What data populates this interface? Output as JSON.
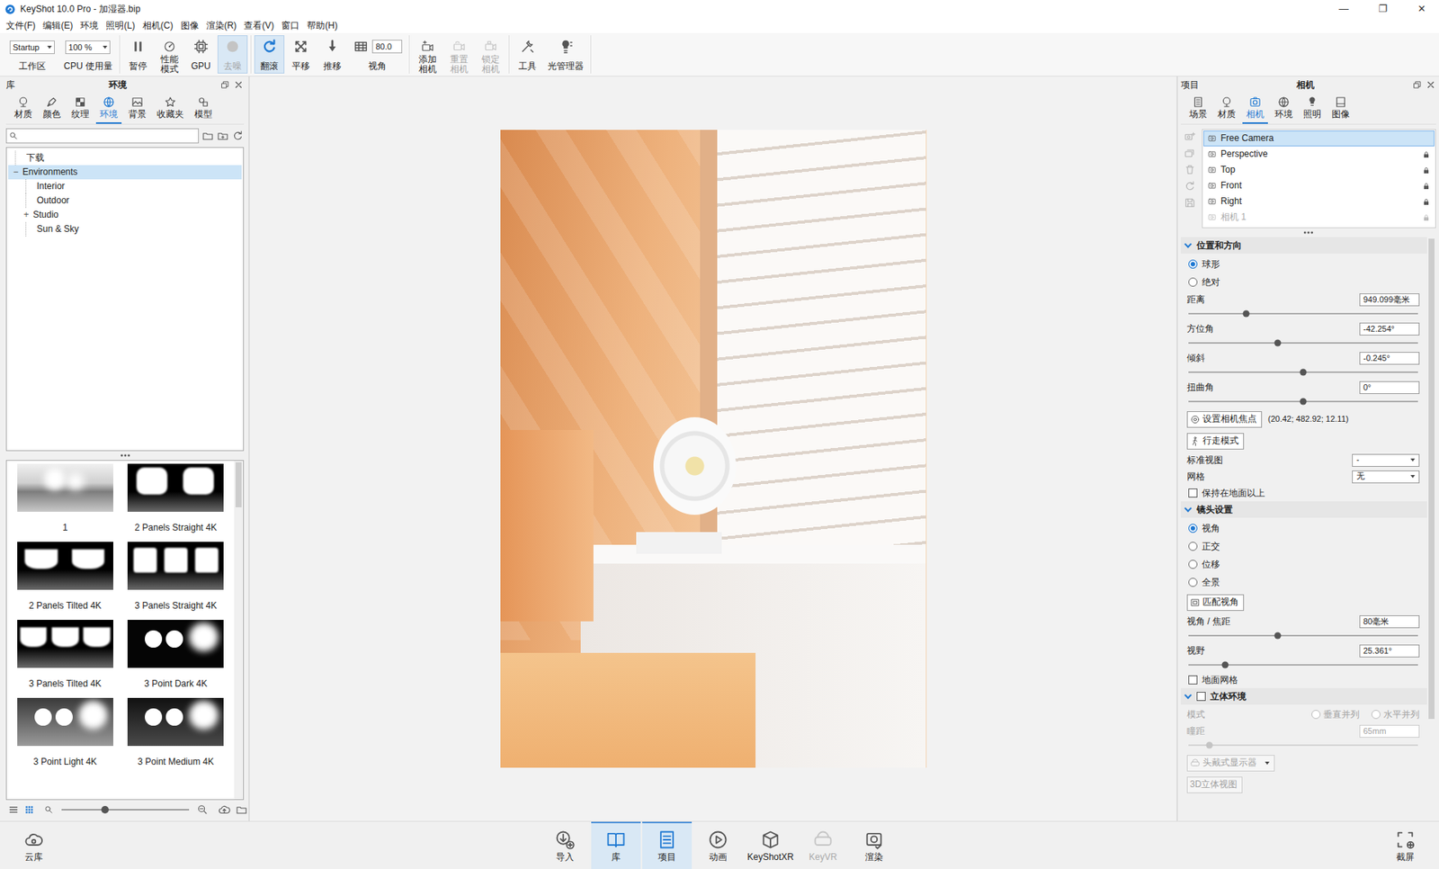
{
  "window": {
    "title": "KeyShot 10.0 Pro - 加湿器.bip",
    "controls": [
      "—",
      "❐",
      "✕"
    ]
  },
  "menu": [
    "文件(F)",
    "编辑(E)",
    "环境",
    "照明(L)",
    "相机(C)",
    "图像",
    "渲染(R)",
    "查看(V)",
    "窗口",
    "帮助(H)"
  ],
  "toolbar": {
    "workspace": {
      "value": "Startup",
      "label": "工作区"
    },
    "cpu": {
      "value": "100 %",
      "label": "CPU 使用量"
    },
    "groups": [
      [
        {
          "label": "暂停",
          "kind": "plain",
          "selected": false,
          "disabled": false
        },
        {
          "label": "性能模式",
          "kind": "stacked",
          "selected": false,
          "disabled": false
        },
        {
          "label": "GPU",
          "kind": "plain",
          "selected": false,
          "disabled": false
        },
        {
          "label": "去噪",
          "kind": "plain",
          "selected": true,
          "disabled": true
        }
      ],
      [
        {
          "label": "翻滚",
          "kind": "plain",
          "selected": true,
          "disabled": false
        },
        {
          "label": "平移",
          "kind": "plain",
          "selected": false,
          "disabled": false
        },
        {
          "label": "推移",
          "kind": "plain",
          "selected": false,
          "disabled": false
        },
        {
          "label": "视角",
          "kind": "field",
          "value": "80.0",
          "selected": false,
          "disabled": false
        }
      ],
      [
        {
          "label": "添加相机",
          "kind": "stacked",
          "selected": false,
          "disabled": false
        },
        {
          "label": "重置相机",
          "kind": "stacked",
          "selected": false,
          "disabled": true
        },
        {
          "label": "锁定相机",
          "kind": "stacked",
          "selected": false,
          "disabled": true
        }
      ],
      [
        {
          "label": "工具",
          "kind": "plain",
          "selected": false,
          "disabled": false
        },
        {
          "label": "光管理器",
          "kind": "plain",
          "selected": false,
          "disabled": false
        }
      ]
    ]
  },
  "library": {
    "title": "库",
    "heading": "环境",
    "tabs": [
      {
        "label": "材质",
        "selected": false
      },
      {
        "label": "颜色",
        "selected": false
      },
      {
        "label": "纹理",
        "selected": false
      },
      {
        "label": "环境",
        "selected": true
      },
      {
        "label": "背景",
        "selected": false
      },
      {
        "label": "收藏夹",
        "selected": false
      },
      {
        "label": "模型",
        "selected": false
      }
    ],
    "tree": [
      {
        "label": "下载",
        "depth": 0,
        "selected": false
      },
      {
        "label": "Environments",
        "depth": 0,
        "toggle": "−",
        "expanded": true,
        "selected": true
      },
      {
        "label": "Interior",
        "depth": 1,
        "selected": false
      },
      {
        "label": "Outdoor",
        "depth": 1,
        "selected": false
      },
      {
        "label": "Studio",
        "depth": 1,
        "toggle": "+",
        "expanded": false,
        "selected": false
      },
      {
        "label": "Sun & Sky",
        "depth": 1,
        "selected": false
      }
    ],
    "thumbnails": [
      {
        "label": "1"
      },
      {
        "label": "2 Panels Straight 4K"
      },
      {
        "label": "2 Panels Tilted 4K"
      },
      {
        "label": "3 Panels Straight 4K"
      },
      {
        "label": "3 Panels Tilted 4K"
      },
      {
        "label": "3 Point Dark 4K"
      },
      {
        "label": "3 Point Light 4K"
      },
      {
        "label": "3 Point Medium 4K"
      }
    ],
    "zoom": {
      "level": 0.34
    }
  },
  "project": {
    "title": "项目",
    "heading": "相机",
    "tabs": [
      {
        "label": "场景",
        "selected": false
      },
      {
        "label": "材质",
        "selected": false
      },
      {
        "label": "相机",
        "selected": true
      },
      {
        "label": "环境",
        "selected": false
      },
      {
        "label": "照明",
        "selected": false
      },
      {
        "label": "图像",
        "selected": false
      }
    ],
    "cameras": [
      {
        "label": "Free Camera",
        "selected": true,
        "locked": false,
        "disabled": false
      },
      {
        "label": "Perspective",
        "selected": false,
        "locked": true,
        "disabled": false
      },
      {
        "label": "Top",
        "selected": false,
        "locked": true,
        "disabled": false
      },
      {
        "label": "Front",
        "selected": false,
        "locked": true,
        "disabled": false
      },
      {
        "label": "Right",
        "selected": false,
        "locked": true,
        "disabled": false
      },
      {
        "label": "相机 1",
        "selected": false,
        "locked": true,
        "disabled": true
      }
    ],
    "sections": [
      {
        "title": "位置和方向",
        "expanded": true,
        "rows": [
          {
            "kind": "radio",
            "label": "球形",
            "selected": true,
            "disabled": false
          },
          {
            "kind": "radio",
            "label": "绝对",
            "selected": false,
            "disabled": false
          },
          {
            "kind": "slider",
            "label": "距离",
            "value": "949.099毫米",
            "level": 0.25,
            "disabled": false
          },
          {
            "kind": "slider",
            "label": "方位角",
            "value": "-42.254°",
            "level": 0.39,
            "disabled": false
          },
          {
            "kind": "slider",
            "label": "倾斜",
            "value": "-0.245°",
            "level": 0.5,
            "disabled": false
          },
          {
            "kind": "slider",
            "label": "扭曲角",
            "value": "0°",
            "level": 0.5,
            "disabled": false
          },
          {
            "kind": "button",
            "label": "设置相机焦点",
            "note": "(20.42; 482.92; 12.11)",
            "disabled": false
          },
          {
            "kind": "button",
            "label": "行走模式",
            "disabled": false
          },
          {
            "kind": "select",
            "label": "标准视图",
            "value": "-",
            "disabled": false
          },
          {
            "kind": "select",
            "label": "网格",
            "value": "无",
            "disabled": false
          },
          {
            "kind": "checkbox",
            "label": "保持在地面以上",
            "checked": false,
            "disabled": false
          }
        ]
      },
      {
        "title": "镜头设置",
        "expanded": true,
        "rows": [
          {
            "kind": "radio",
            "label": "视角",
            "selected": true,
            "disabled": false
          },
          {
            "kind": "radio",
            "label": "正交",
            "selected": false,
            "disabled": false
          },
          {
            "kind": "radio",
            "label": "位移",
            "selected": false,
            "disabled": false
          },
          {
            "kind": "radio",
            "label": "全景",
            "selected": false,
            "disabled": false
          },
          {
            "kind": "button",
            "label": "匹配视角",
            "disabled": false
          },
          {
            "kind": "slider",
            "label": "视角 / 焦距",
            "value": "80毫米",
            "level": 0.39,
            "disabled": false
          },
          {
            "kind": "slider",
            "label": "视野",
            "value": "25.361°",
            "level": 0.16,
            "disabled": false
          },
          {
            "kind": "checkbox",
            "label": "地面网格",
            "checked": false,
            "disabled": false
          }
        ]
      },
      {
        "title": "立体环境",
        "expanded": true,
        "checkbox": false,
        "rows": [
          {
            "kind": "radiogroup",
            "label": "模式",
            "disabled": true,
            "options": [
              {
                "label": "垂直并列",
                "selected": false
              },
              {
                "label": "水平并列",
                "selected": false
              }
            ]
          },
          {
            "kind": "slider",
            "label": "瞳距",
            "value": "65mm",
            "level": 0.09,
            "disabled": true
          },
          {
            "kind": "button",
            "label": "头戴式显示器",
            "dropdown": true,
            "disabled": true
          },
          {
            "kind": "button",
            "label": "3D立体视图",
            "disabled": true
          }
        ]
      }
    ]
  },
  "dock": {
    "left": {
      "label": "云库"
    },
    "items": [
      {
        "label": "导入",
        "selected": false,
        "disabled": false
      },
      {
        "label": "库",
        "selected": true,
        "disabled": false
      },
      {
        "label": "项目",
        "selected": true,
        "disabled": false
      },
      {
        "label": "动画",
        "selected": false,
        "disabled": false
      },
      {
        "label": "KeyShotXR",
        "selected": false,
        "disabled": false
      },
      {
        "label": "KeyVR",
        "selected": false,
        "disabled": true
      },
      {
        "label": "渲染",
        "selected": false,
        "disabled": false
      }
    ],
    "right": {
      "label": "截屏"
    }
  }
}
